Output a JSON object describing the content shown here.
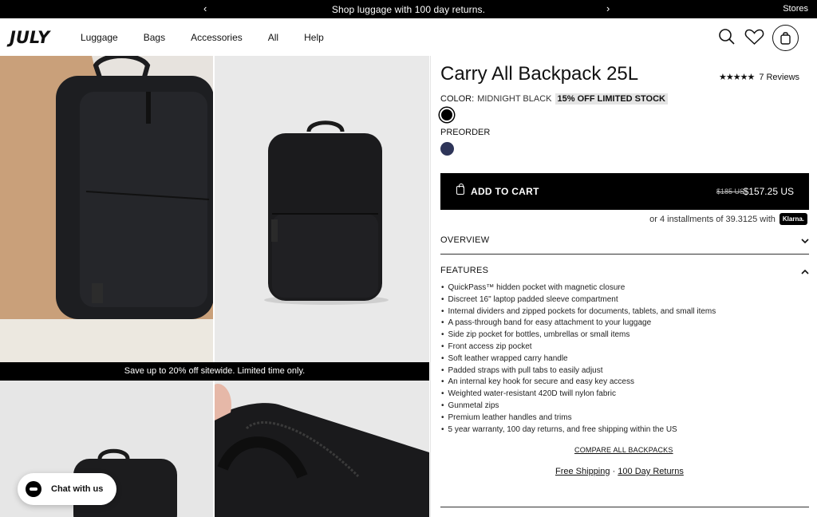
{
  "announcement": {
    "message": "Shop luggage with 100 day returns.",
    "stores": "Stores"
  },
  "header": {
    "logo": "JULY",
    "nav": [
      "Luggage",
      "Bags",
      "Accessories",
      "All",
      "Help"
    ]
  },
  "gallery": {
    "promo": "Save up to 20% off sitewide. Limited time only."
  },
  "chat": {
    "label": "Chat with us"
  },
  "product": {
    "title": "Carry All Backpack 25L",
    "stars": "★★★★★",
    "reviews": "7 Reviews",
    "color_label": "COLOR:",
    "color_value": "MIDNIGHT BLACK",
    "badge": "15% OFF LIMITED STOCK",
    "preorder": "PREORDER",
    "swatches": [
      "#000000",
      "#2e3559"
    ],
    "add_to_cart": "ADD TO CART",
    "old_price": "$185 US",
    "price": "$157.25 US",
    "installments": "or 4 installments of 39.3125 with",
    "klarna": "Klarna.",
    "overview": "OVERVIEW",
    "features_title": "FEATURES",
    "features": [
      "QuickPass™ hidden pocket with magnetic closure",
      "Discreet 16\" laptop padded sleeve compartment",
      "Internal dividers and zipped pockets for documents, tablets, and small items",
      "A pass-through band for easy attachment to your luggage",
      "Side zip pocket for bottles, umbrellas or small items",
      "Front access zip pocket",
      "Soft leather wrapped carry handle",
      "Padded straps with pull tabs to easily adjust",
      "An internal key hook for secure and easy key access",
      "Weighted water-resistant 420D twill nylon fabric",
      "Gunmetal zips",
      "Premium leather handles and trims",
      "5 year warranty, 100 day returns, and free shipping within the US"
    ],
    "compare": "COMPARE ALL BACKPACKS",
    "free_shipping": "Free Shipping",
    "separator": "·",
    "returns": "100 Day Returns"
  },
  "icons": [
    "chevron-left-icon",
    "chevron-right-icon",
    "search-icon",
    "heart-icon",
    "cart-icon",
    "chevron-down-icon",
    "chevron-up-icon"
  ]
}
